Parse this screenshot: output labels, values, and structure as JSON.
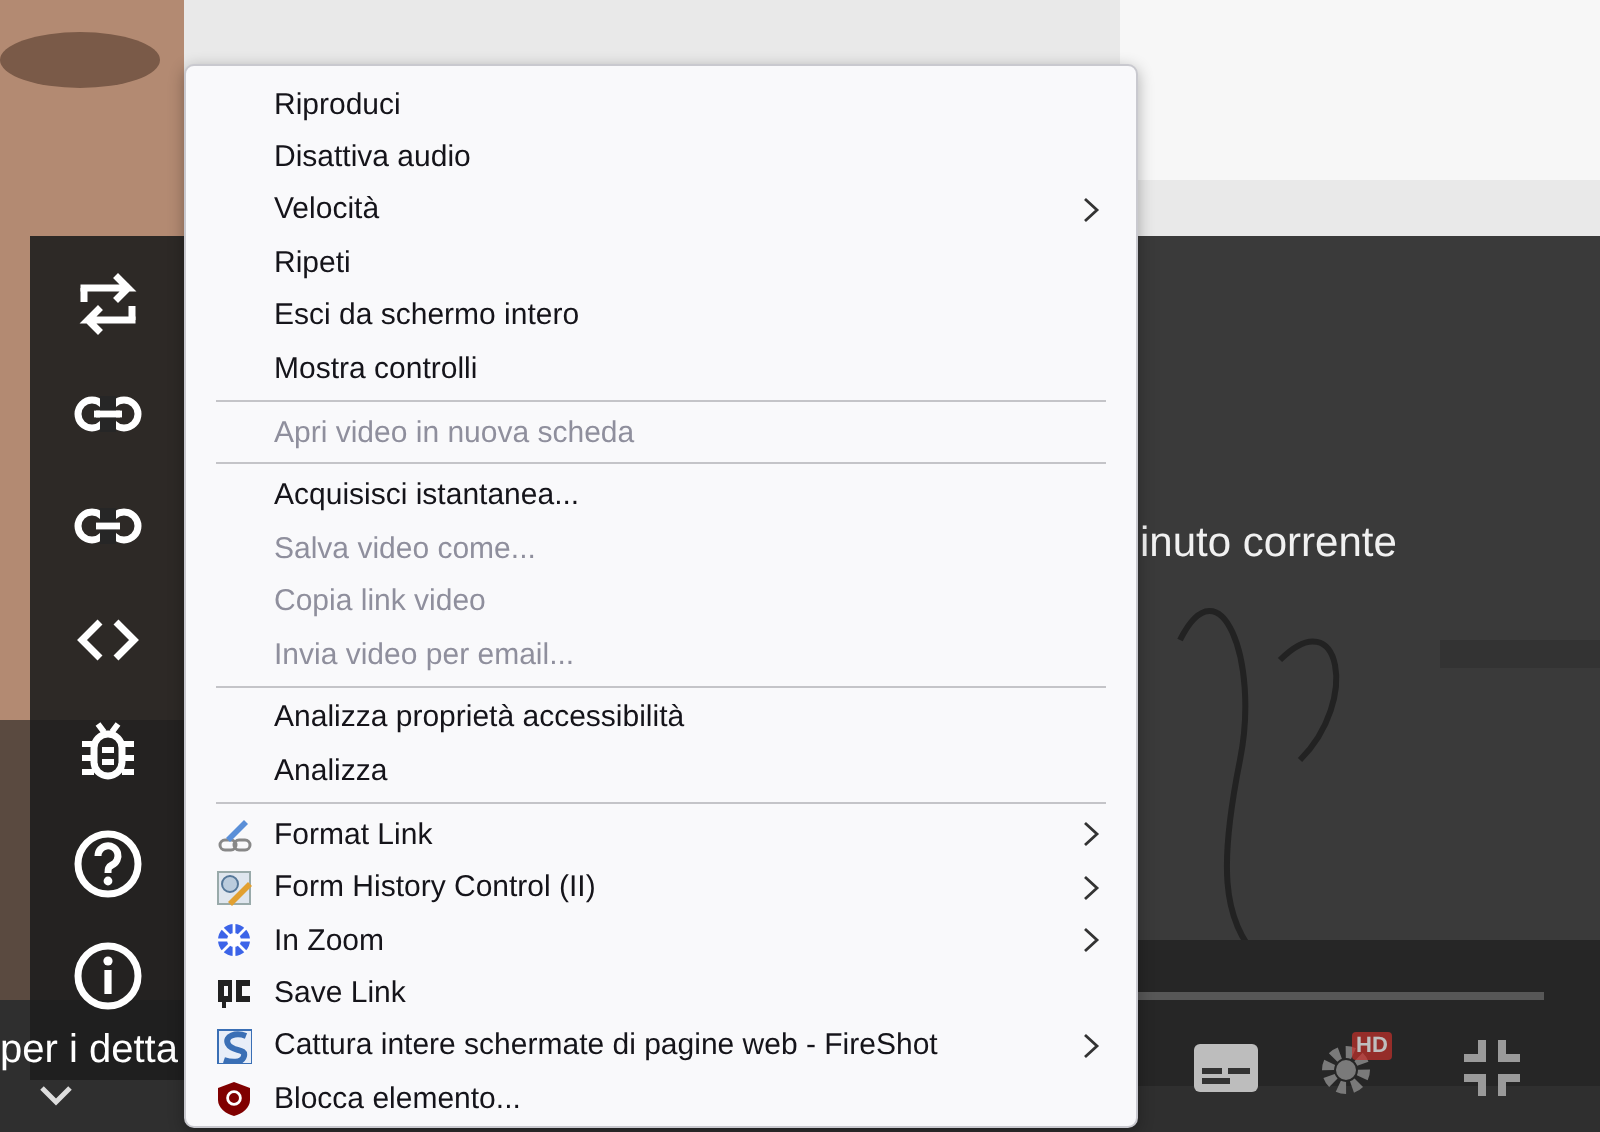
{
  "player": {
    "caption_right": "inuto corrente",
    "caption_left": "per i detta",
    "hd_badge": "HD"
  },
  "context_menu": {
    "items": [
      {
        "kind": "item",
        "label": "Riproduci",
        "disabled": false,
        "submenu": false
      },
      {
        "kind": "item",
        "label": "Disattiva audio",
        "disabled": false,
        "submenu": false
      },
      {
        "kind": "item",
        "label": "Velocità",
        "disabled": false,
        "submenu": true
      },
      {
        "kind": "item",
        "label": "Ripeti",
        "disabled": false,
        "submenu": false
      },
      {
        "kind": "item",
        "label": "Esci da schermo intero",
        "disabled": false,
        "submenu": false
      },
      {
        "kind": "item",
        "label": "Mostra controlli",
        "disabled": false,
        "submenu": false
      },
      {
        "kind": "separator"
      },
      {
        "kind": "item",
        "label": "Apri video in nuova scheda",
        "disabled": true,
        "submenu": false
      },
      {
        "kind": "separator"
      },
      {
        "kind": "item",
        "label": "Acquisisci istantanea...",
        "disabled": false,
        "submenu": false
      },
      {
        "kind": "item",
        "label": "Salva video come...",
        "disabled": true,
        "submenu": false
      },
      {
        "kind": "item",
        "label": "Copia link video",
        "disabled": true,
        "submenu": false
      },
      {
        "kind": "item",
        "label": "Invia video per email...",
        "disabled": true,
        "submenu": false
      },
      {
        "kind": "separator"
      },
      {
        "kind": "item",
        "label": "Analizza proprietà accessibilità",
        "disabled": false,
        "submenu": false
      },
      {
        "kind": "item",
        "label": "Analizza",
        "disabled": false,
        "submenu": false
      },
      {
        "kind": "separator"
      },
      {
        "kind": "extension",
        "label": "Format Link",
        "disabled": false,
        "submenu": true
      },
      {
        "kind": "extension",
        "label": "Form History Control (II)",
        "disabled": false,
        "submenu": true
      },
      {
        "kind": "extension",
        "label": "In Zoom",
        "disabled": false,
        "submenu": true
      },
      {
        "kind": "extension",
        "label": "Save Link",
        "disabled": false,
        "submenu": false
      },
      {
        "kind": "extension",
        "label": "Cattura intere schermate di pagine web - FireShot",
        "disabled": false,
        "submenu": true
      },
      {
        "kind": "extension",
        "label": "Blocca elemento...",
        "disabled": false,
        "submenu": false
      }
    ]
  }
}
